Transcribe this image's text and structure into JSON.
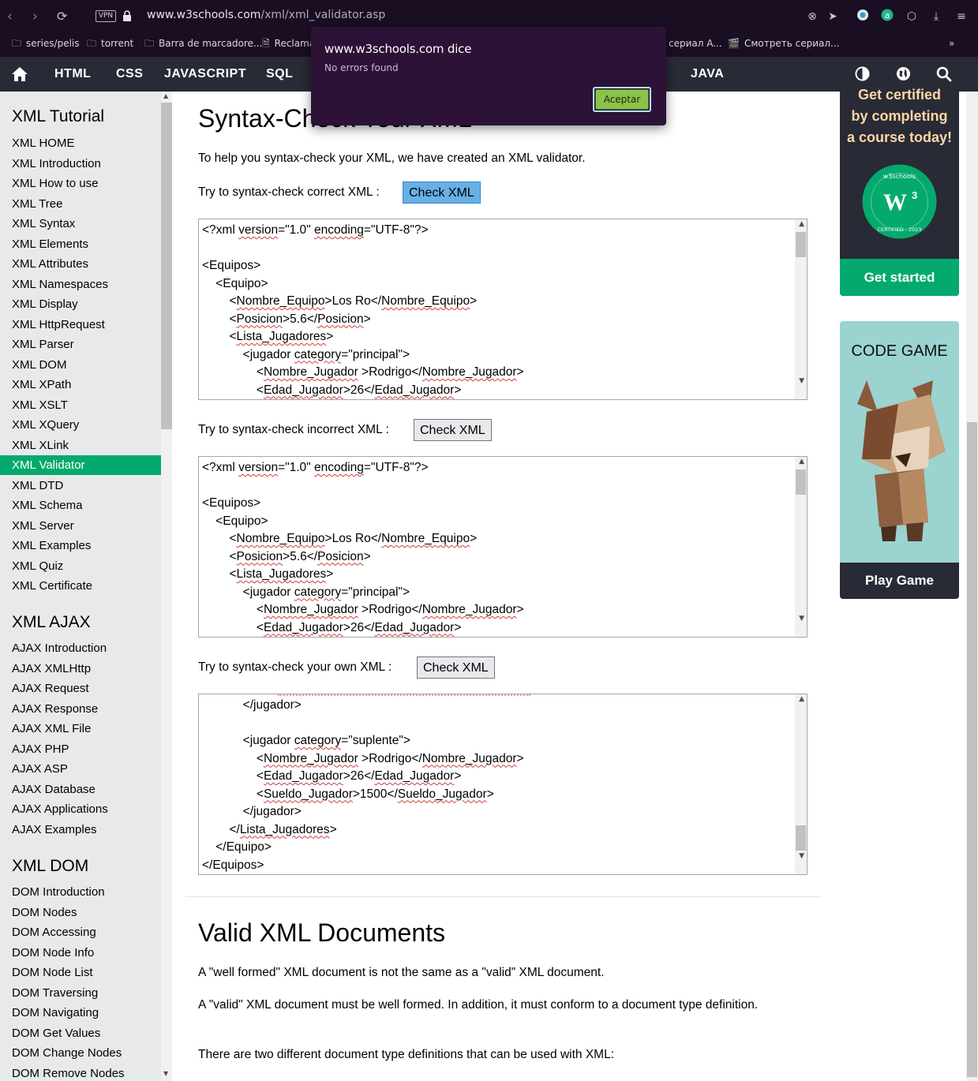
{
  "browser": {
    "vpn_label": "VPN",
    "url_host": "www.w3schools.com",
    "url_path": "/xml/xml_validator.asp",
    "bookmarks": [
      "series/pelis",
      "torrent",
      "Barra de marcadore...",
      "Reclama",
      "сериал A...",
      "Смотреть сериал..."
    ]
  },
  "dialog": {
    "title": "www.w3schools.com dice",
    "message": "No errors found",
    "accept_label": "Aceptar"
  },
  "topnav": {
    "items": [
      "HTML",
      "CSS",
      "JAVASCRIPT",
      "SQL",
      "JAVA"
    ]
  },
  "sidebar": {
    "sections": [
      {
        "title": "XML Tutorial",
        "items": [
          "XML HOME",
          "XML Introduction",
          "XML How to use",
          "XML Tree",
          "XML Syntax",
          "XML Elements",
          "XML Attributes",
          "XML Namespaces",
          "XML Display",
          "XML HttpRequest",
          "XML Parser",
          "XML DOM",
          "XML XPath",
          "XML XSLT",
          "XML XQuery",
          "XML XLink",
          "XML Validator",
          "XML DTD",
          "XML Schema",
          "XML Server",
          "XML Examples",
          "XML Quiz",
          "XML Certificate"
        ]
      },
      {
        "title": "XML AJAX",
        "items": [
          "AJAX Introduction",
          "AJAX XMLHttp",
          "AJAX Request",
          "AJAX Response",
          "AJAX XML File",
          "AJAX PHP",
          "AJAX ASP",
          "AJAX Database",
          "AJAX Applications",
          "AJAX Examples"
        ]
      },
      {
        "title": "XML DOM",
        "items": [
          "DOM Introduction",
          "DOM Nodes",
          "DOM Accessing",
          "DOM Node Info",
          "DOM Node List",
          "DOM Traversing",
          "DOM Navigating",
          "DOM Get Values",
          "DOM Change Nodes",
          "DOM Remove Nodes"
        ]
      }
    ],
    "active_item": "XML Validator"
  },
  "main": {
    "heading": "Syntax-Check Your XML",
    "intro": "To help you syntax-check your XML, we have created an XML validator.",
    "try_correct": "Try to syntax-check correct XML :",
    "try_incorrect": "Try to syntax-check incorrect XML :",
    "try_own": "Try to syntax-check your own XML :",
    "check_label": "Check XML",
    "textarea1_lines": [
      "<?xml version=\"1.0\" encoding=\"UTF-8\"?>",
      "",
      "<Equipos>",
      "    <Equipo>",
      "        <Nombre_Equipo>Los Ro</Nombre_Equipo>",
      "        <Posicion>5.6</Posicion>",
      "        <Lista_Jugadores>",
      "            <jugador category=\"principal\">",
      "                <Nombre_Jugador >Rodrigo</Nombre_Jugador>",
      "                <Edad_Jugador>26</Edad_Jugador>"
    ],
    "textarea2_lines": [
      "<?xml version=\"1.0\" encoding=\"UTF-8\"?>",
      "",
      "<Equipos>",
      "    <Equipo>",
      "        <Nombre_Equipo>Los Ro</Nombre_Equipo>",
      "        <Posicion>5.6</Posicion>",
      "        <Lista_Jugadores>",
      "            <jugador category=\"principal\">",
      "                <Nombre_Jugador >Rodrigo</Nombre_Jugador>",
      "                <Edad_Jugador>26</Edad_Jugador>"
    ],
    "textarea3_lines": [
      "            </jugador>",
      "",
      "            <jugador category=\"suplente\">",
      "                <Nombre_Jugador >Rodrigo</Nombre_Jugador>",
      "                <Edad_Jugador>26</Edad_Jugador>",
      "                <Sueldo_Jugador>1500</Sueldo_Jugador>",
      "            </jugador>",
      "        </Lista_Jugadores>",
      "    </Equipo>",
      "</Equipos>"
    ],
    "valid_heading": "Valid XML Documents",
    "valid_p1": "A \"well formed\" XML document is not the same as a \"valid\" XML document.",
    "valid_p2": "A \"valid\" XML document must be well formed. In addition, it must conform to a document type definition.",
    "valid_p3": "There are two different document type definitions that can be used with XML:"
  },
  "ads": {
    "cert_line1": "Get certified",
    "cert_line2": "by completing",
    "cert_line3": "a course today!",
    "badge_top": "w3schools",
    "badge_bottom": "CERTIFIED . 2023",
    "get_started": "Get started",
    "code_game": "CODE GAME",
    "play_game": "Play Game"
  },
  "colors": {
    "w3_green": "#04aa6d",
    "nav_dark": "#282a35",
    "browser_dark": "#1a0f22",
    "dialog_bg": "#2b1236",
    "ok_button": "#8bc34a"
  }
}
